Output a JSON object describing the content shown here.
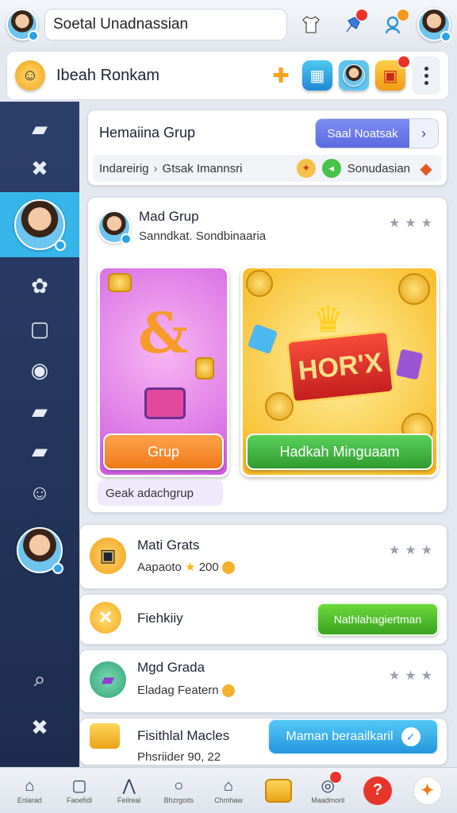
{
  "topbar": {
    "search_value": "Soetal Unadnassian",
    "icons": [
      "avatar",
      "shirt-icon",
      "pin-icon",
      "user-alert-icon",
      "avatar"
    ],
    "badges": {
      "pin": "",
      "user_alert": ""
    }
  },
  "header": {
    "title": "Ibeah Ronkam",
    "app_tiles": [
      "puzzle-icon",
      "folder-app-icon",
      "avatar-app-icon",
      "chest-app-icon"
    ]
  },
  "group_card": {
    "title": "Hemaiina Grup",
    "button_label": "Saal Noatsak",
    "breadcrumb_first": "Indareirig",
    "breadcrumb_second": "Gtsak Imannsri",
    "breadcrumb_end": "Sonudasian"
  },
  "mad_card": {
    "name": "Mad Grup",
    "subtitle": "Sanndkat. Sondbinaaria",
    "stars": "★★★",
    "promo_left_button": "Grup",
    "promo_right_button": "Hadkah Minguaam",
    "gift_text": "HOR'X",
    "chip": "Geak adachgrup"
  },
  "rows": [
    {
      "title": "Mati Grats",
      "sub": "Aapaoto",
      "amount": "200",
      "stars": "★★★"
    },
    {
      "title": "Fiehkiiy",
      "button": "Nathlahagiertman"
    },
    {
      "title": "Mgd Grada",
      "sub": "Eladag Featern",
      "stars": "★★★"
    },
    {
      "title": "Fisithlal Macles",
      "sub": "Phsriider 90, 22",
      "button": "Maman beraailkaril"
    }
  ],
  "bottom_nav": [
    {
      "label": "Enlarad",
      "icon": "home-icon"
    },
    {
      "label": "Faoefidl",
      "icon": "box-icon"
    },
    {
      "label": "Feilreai",
      "icon": "tent-icon"
    },
    {
      "label": "Bhzrgoits",
      "icon": "search-icon"
    },
    {
      "label": "Chmhaw",
      "icon": "house-icon"
    },
    {
      "label": "",
      "icon": "gold-bar-icon"
    },
    {
      "label": "Maadmoril",
      "icon": "chat-icon"
    },
    {
      "label": "",
      "icon": "red-badge-icon"
    },
    {
      "label": "",
      "icon": "orange-badge-icon"
    }
  ],
  "colors": {
    "sidebar": "#2c3f6b",
    "active_sidebar": "#35b5ea",
    "accent_blue": "#5b6ae0",
    "accent_green": "#3aa41f",
    "accent_orange": "#f07a1a"
  }
}
